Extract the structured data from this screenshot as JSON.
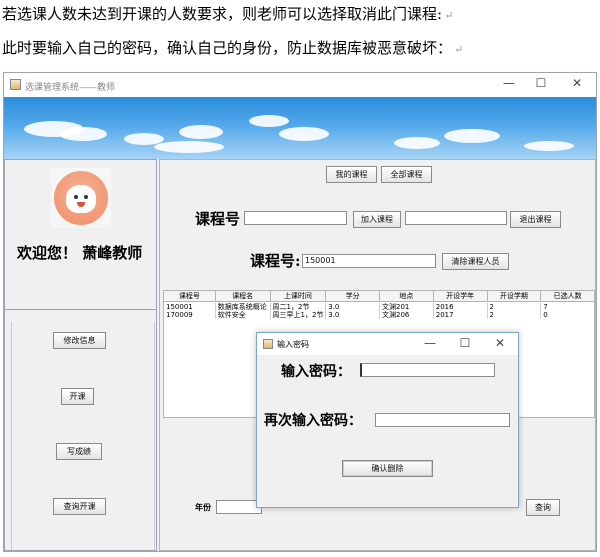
{
  "doc": {
    "line1": "若选课人数未达到开课的人数要求，则老师可以选择取消此门课程:",
    "line2": "此时要输入自己的密码，确认自己的身份，防止数据库被恶意破坏：",
    "para_mark": "↵"
  },
  "window": {
    "title": "选课管理系统——教师",
    "minimize": "—",
    "maximize": "☐",
    "close": "✕"
  },
  "left": {
    "welcome": "欢迎您！ 萧峰教师",
    "buttons": [
      "修改信息",
      "开课",
      "写成绩",
      "查询开课"
    ]
  },
  "top_buttons": {
    "my_courses": "我的课程",
    "all_courses": "全部课程"
  },
  "course_row1": {
    "label": "课程号",
    "input_value": "",
    "join_button": "加入课程",
    "input2_value": "",
    "quit_button": "退出课程"
  },
  "course_row2": {
    "label": "课程号:",
    "input_value": "150001",
    "clear_button": "清除课程人员"
  },
  "table": {
    "headers": [
      "课程号",
      "课程名",
      "上课时间",
      "学分",
      "地点",
      "开设学年",
      "开设学期",
      "已选人数"
    ],
    "rows": [
      [
        "150001",
        "数据库系统概论",
        "周二1，2节",
        "3.0",
        "文渊201",
        "2016",
        "2",
        "7"
      ],
      [
        "170009",
        "软件安全",
        "周三早上1，2节",
        "3.0",
        "文渊206",
        "2017",
        "2",
        "0"
      ]
    ]
  },
  "bottom": {
    "year_label": "年份",
    "query_button": "查询"
  },
  "dialog": {
    "title": "输入密码",
    "minimize": "—",
    "maximize": "☐",
    "close": "✕",
    "password_label": "输入密码：",
    "password_value": "",
    "confirm_label": "再次输入密码：",
    "confirm_value": "",
    "confirm_button": "确认删除"
  }
}
